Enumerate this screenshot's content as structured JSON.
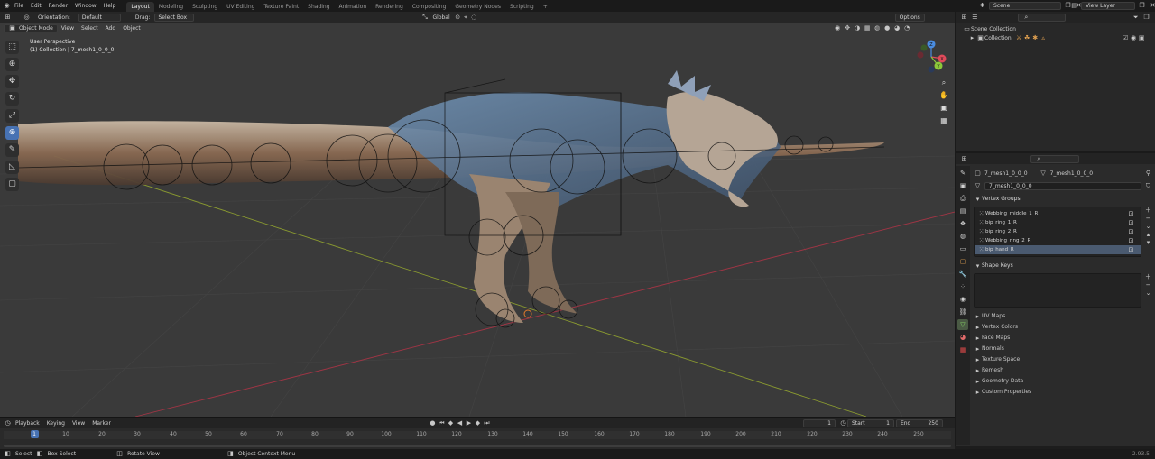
{
  "topbar": {
    "menus": [
      "File",
      "Edit",
      "Render",
      "Window",
      "Help"
    ],
    "workspaces": [
      "Layout",
      "Modeling",
      "Sculpting",
      "UV Editing",
      "Texture Paint",
      "Shading",
      "Animation",
      "Rendering",
      "Compositing",
      "Geometry Nodes",
      "Scripting"
    ],
    "active_workspace": "Layout",
    "add_tab": "+",
    "scene_value": "Scene",
    "view_layer_value": "View Layer"
  },
  "viewport": {
    "orientation_label": "Orientation:",
    "orientation_value": "Default",
    "drag_label": "Drag:",
    "drag_value": "Select Box",
    "transform_value": "Global",
    "options_label": "Options",
    "mode_value": "Object Mode",
    "menus": [
      "View",
      "Select",
      "Add",
      "Object"
    ],
    "overlay_title": "User Perspective",
    "overlay_subtitle": "(1) Collection | 7_mesh1_0_0_0",
    "gizmo_x": "X",
    "gizmo_y": "Y",
    "gizmo_z": "Z"
  },
  "outliner": {
    "scene_collection": "Scene Collection",
    "collection": "Collection"
  },
  "properties": {
    "object_name": "7_mesh1_0_0_0",
    "mesh_name": "7_mesh1_0_0_0",
    "data_field": "7_mesh1_0_0_0",
    "vertex_groups_label": "Vertex Groups",
    "vertex_groups": [
      "Webbing_middle_1_R",
      "bip_ring_1_R",
      "bip_ring_2_R",
      "Webbing_ring_2_R",
      "bip_hand_R"
    ],
    "selected_group_index": 4,
    "shape_keys_label": "Shape Keys",
    "collapsed_sections": [
      "UV Maps",
      "Vertex Colors",
      "Face Maps",
      "Normals",
      "Texture Space",
      "Remesh",
      "Geometry Data",
      "Custom Properties"
    ]
  },
  "timeline": {
    "menus": [
      "Playback",
      "Keying",
      "View",
      "Marker"
    ],
    "current_frame": "1",
    "start_label": "Start",
    "start_value": "1",
    "end_label": "End",
    "end_value": "250",
    "ruler": [
      "1",
      "10",
      "20",
      "30",
      "40",
      "50",
      "60",
      "70",
      "80",
      "90",
      "100",
      "110",
      "120",
      "130",
      "140",
      "150",
      "160",
      "170",
      "180",
      "190",
      "200",
      "210",
      "220",
      "230",
      "240",
      "250"
    ]
  },
  "statusbar": {
    "select": "Select",
    "box_select": "Box Select",
    "rotate_view": "Rotate View",
    "context_menu": "Object Context Menu",
    "version": "2.93.5"
  },
  "colors": {
    "accent": "#4772b3",
    "x_axis": "#e04a5a",
    "y_axis": "#8cc83a",
    "z_axis": "#4a8ce0"
  }
}
